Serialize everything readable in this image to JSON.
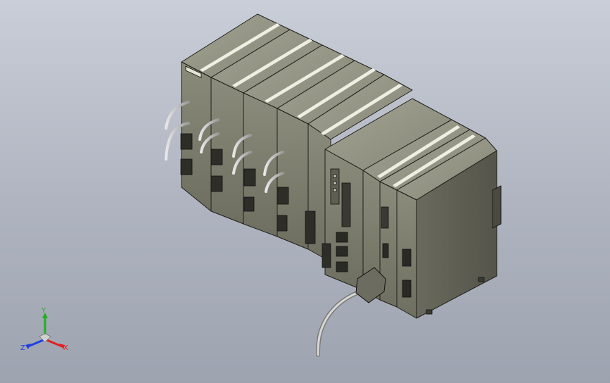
{
  "viewport": {
    "background_top": "#c9ced8",
    "background_bottom": "#9ea3b0"
  },
  "model": {
    "description_hidden": "",
    "module_count": 9,
    "body_color": "#8a8a78",
    "dark_color": "#4a4a42",
    "cable_color": "#c8c8c8"
  },
  "triad": {
    "x_label": "X",
    "y_label": "Y",
    "z_label": "Z",
    "x_color": "#e02020",
    "y_color": "#20b020",
    "z_color": "#2040e0"
  }
}
